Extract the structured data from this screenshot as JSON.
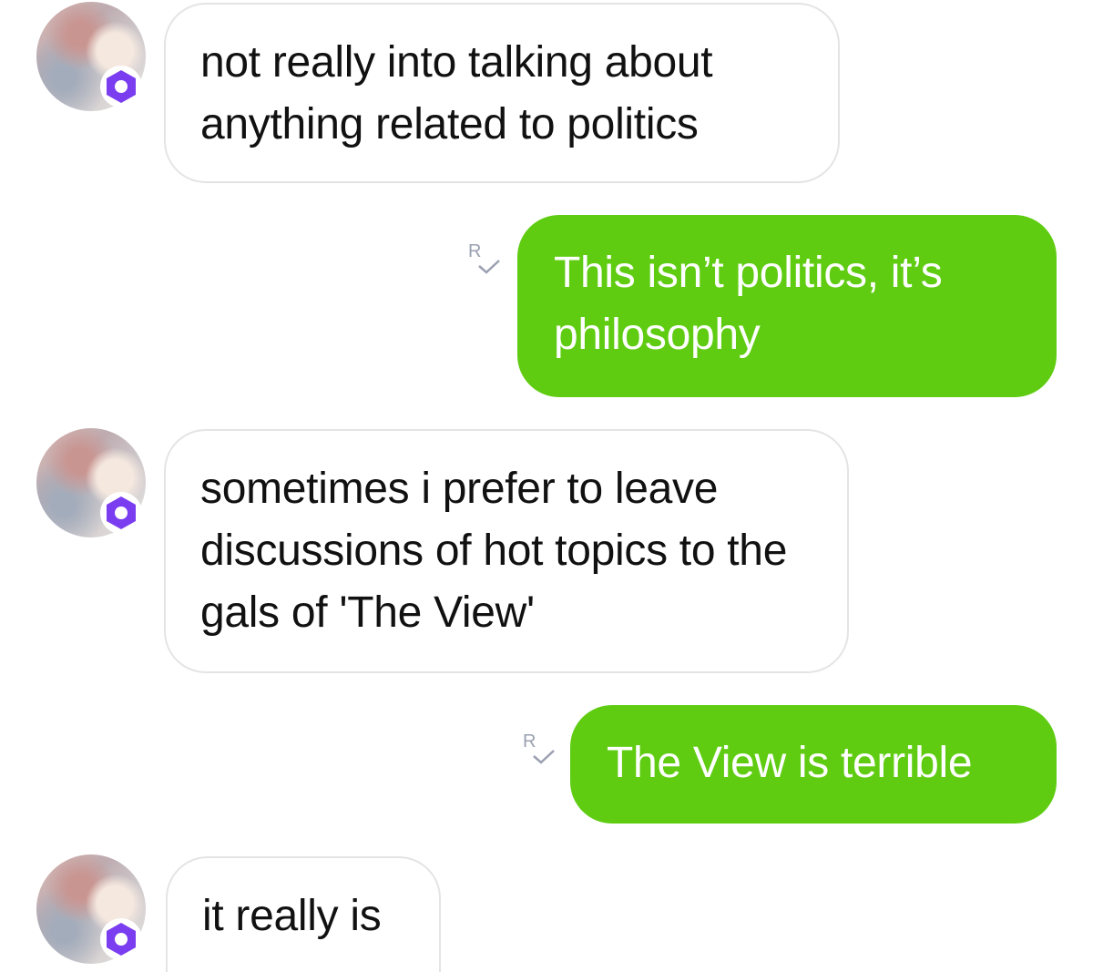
{
  "messages": [
    {
      "direction": "incoming",
      "text": "not really into talking about anything related to politics"
    },
    {
      "direction": "outgoing",
      "text": "This isn’t politics, it’s philosophy",
      "receipt_icon": "read-receipt-icon"
    },
    {
      "direction": "incoming",
      "text": "sometimes i prefer to leave discussions of hot topics to the gals of 'The View'"
    },
    {
      "direction": "outgoing",
      "text": "The View is terrible",
      "receipt_icon": "read-receipt-icon"
    },
    {
      "direction": "incoming",
      "text": "it really is"
    }
  ],
  "colors": {
    "outgoing_bubble": "#5fcc12",
    "incoming_border": "#e4e4e4",
    "badge": "#7a3df0",
    "receipt": "#9aa0b0"
  },
  "avatar_badge_icon": "hexagon-badge-icon"
}
